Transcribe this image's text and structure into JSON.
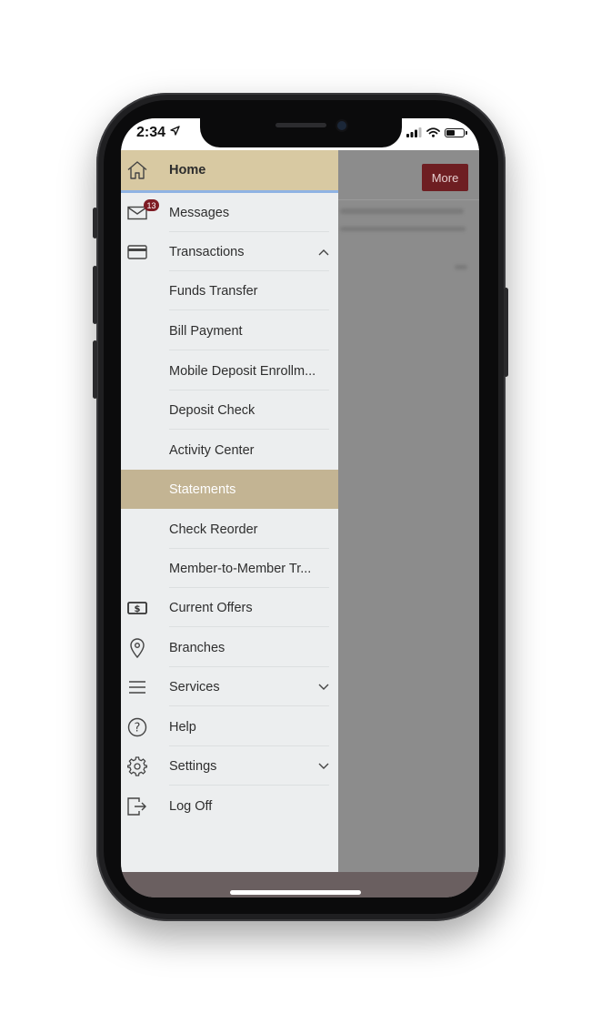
{
  "status_bar": {
    "time": "2:34"
  },
  "header": {
    "more_label": "More"
  },
  "menu": {
    "home": "Home",
    "messages": {
      "label": "Messages",
      "badge": "13"
    },
    "transactions": "Transactions",
    "sub": {
      "funds_transfer": "Funds Transfer",
      "bill_payment": "Bill Payment",
      "mobile_deposit": "Mobile Deposit Enrollm...",
      "deposit_check": "Deposit Check",
      "activity_center": "Activity Center",
      "statements": "Statements",
      "check_reorder": "Check Reorder",
      "member_transfer": "Member-to-Member Tr..."
    },
    "current_offers": "Current Offers",
    "branches": "Branches",
    "services": "Services",
    "help": "Help",
    "settings": "Settings",
    "log_off": "Log Off"
  },
  "colors": {
    "home_highlight": "#d8c9a2",
    "active_highlight": "#c3b493",
    "badge": "#7e1b24",
    "more_button": "#6e1e22"
  }
}
